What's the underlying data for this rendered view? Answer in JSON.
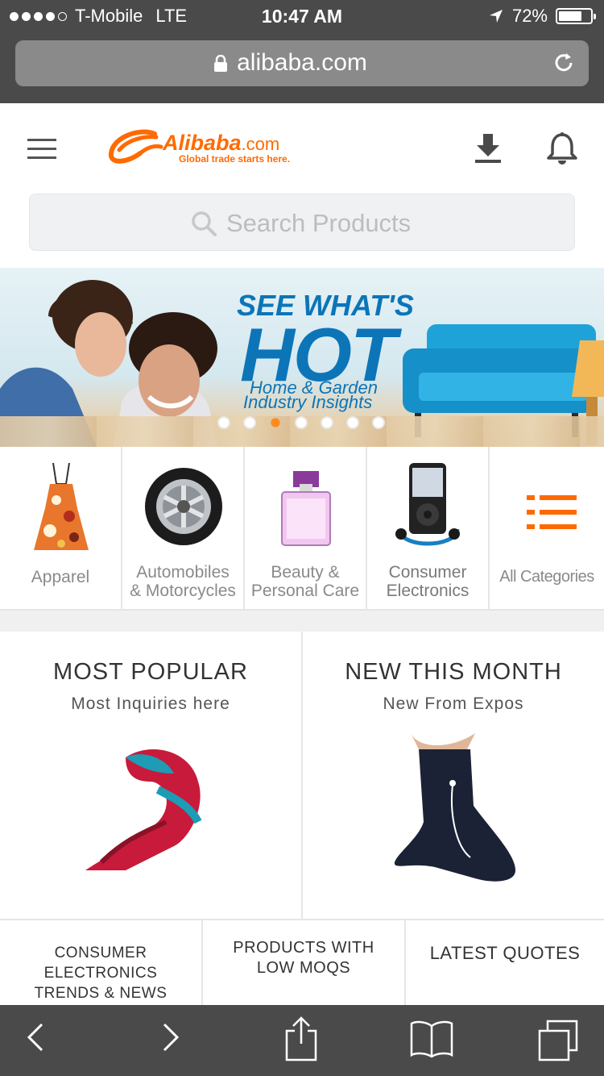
{
  "status_bar": {
    "carrier": "T-Mobile",
    "network": "LTE",
    "time": "10:47 AM",
    "battery": "72%",
    "battery_level": 0.72
  },
  "browser": {
    "url": "alibaba.com"
  },
  "header": {
    "logo_brand": "Alibaba",
    "logo_domain": ".com",
    "logo_tagline": "Global trade starts here."
  },
  "search": {
    "placeholder": "Search Products"
  },
  "banner": {
    "line1": "SEE WHAT'S",
    "line2": "HOT",
    "line3": "Home & Garden",
    "line4": "Industry Insights",
    "slides_total": 7,
    "active_slide": 3
  },
  "categories": [
    {
      "line1": "Apparel",
      "line2": ""
    },
    {
      "line1": "Automobiles",
      "line2": "& Motorcycles"
    },
    {
      "line1": "Beauty &",
      "line2": "Personal Care"
    },
    {
      "line1": "Consumer",
      "line2": "Electronics"
    },
    {
      "line1": "All Categories",
      "line2": ""
    }
  ],
  "tiles": [
    {
      "title": "MOST POPULAR",
      "subtitle": "Most Inquiries here"
    },
    {
      "title": "NEW THIS MONTH",
      "subtitle": "New From Expos"
    }
  ],
  "bottom_row": [
    {
      "line1": "CONSUMER ELECTRONICS",
      "line2": "TRENDS & NEWS"
    },
    {
      "line1": "PRODUCTS WITH",
      "line2": "LOW MOQS"
    },
    {
      "line1": "LATEST QUOTES",
      "line2": ""
    }
  ],
  "colors": {
    "brand_orange": "#ff6a00",
    "banner_blue": "#0c75b8",
    "safari_gray": "#4a4a4a"
  },
  "icons": [
    "signal-icon",
    "location-arrow-icon",
    "battery-icon",
    "lock-icon",
    "reload-icon",
    "hamburger-icon",
    "download-icon",
    "bell-icon",
    "search-icon",
    "back-icon",
    "forward-icon",
    "share-icon",
    "bookmarks-icon",
    "tabs-icon"
  ]
}
